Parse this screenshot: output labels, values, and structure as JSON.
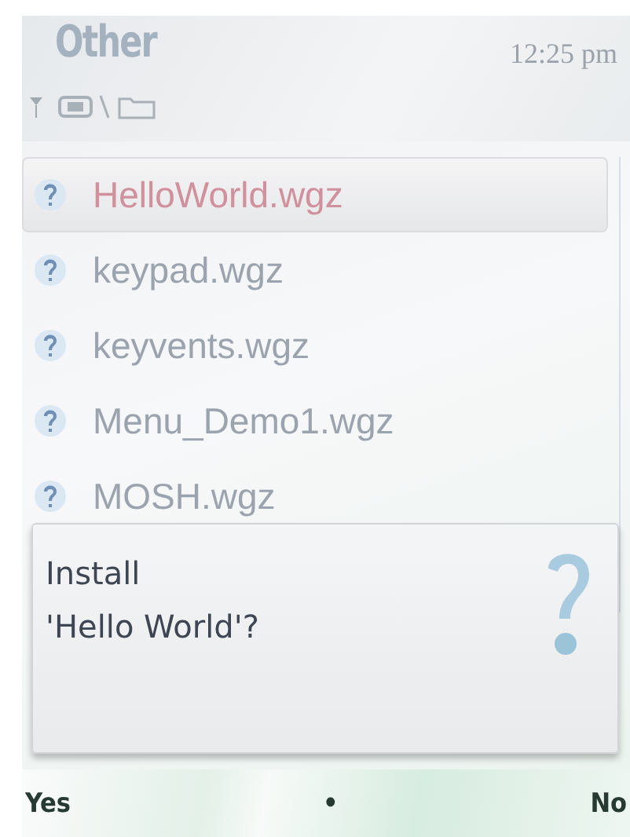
{
  "status_pane": {
    "title": "Other",
    "time": "12:25 pm"
  },
  "list": {
    "items": [
      {
        "name": "HelloWorld.wgz",
        "selected": true
      },
      {
        "name": "keypad.wgz",
        "selected": false
      },
      {
        "name": "keyvents.wgz",
        "selected": false
      },
      {
        "name": "Menu_Demo1.wgz",
        "selected": false
      },
      {
        "name": "MOSH.wgz",
        "selected": false
      }
    ]
  },
  "dialog": {
    "lines": [
      "Install",
      "'Hello World'?"
    ]
  },
  "softkeys": {
    "left": "Yes",
    "middle": "•",
    "right": "No"
  }
}
